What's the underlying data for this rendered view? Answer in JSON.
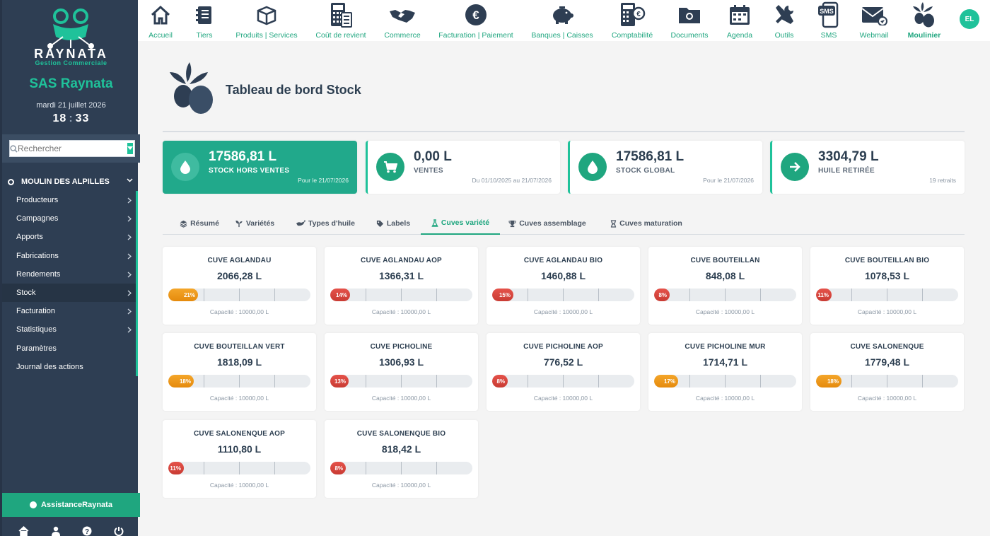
{
  "sidebar": {
    "brand": "RAYNATA",
    "brand_sub": "Gestion Commerciale",
    "company": "SAS Raynata",
    "date": "mardi 21 juillet 2026",
    "time_h": "18",
    "time_m": "33",
    "search_placeholder": "Rechercher",
    "group": "MOULIN DES ALPILLES",
    "items": [
      {
        "label": "Producteurs",
        "arrow": true
      },
      {
        "label": "Campagnes",
        "arrow": true
      },
      {
        "label": "Apports",
        "arrow": true
      },
      {
        "label": "Fabrications",
        "arrow": true
      },
      {
        "label": "Rendements",
        "arrow": true
      },
      {
        "label": "Stock",
        "arrow": true,
        "active": true
      },
      {
        "label": "Facturation",
        "arrow": true
      },
      {
        "label": "Statistiques",
        "arrow": true
      },
      {
        "label": "Paramètres",
        "arrow": false
      },
      {
        "label": "Journal des actions",
        "arrow": false
      }
    ],
    "assist": "AssistanceRaynata",
    "bottom_icons": [
      "home-icon",
      "user-icon",
      "help-icon",
      "power-icon"
    ]
  },
  "topnav": {
    "items": [
      {
        "label": "Accueil",
        "icon": "home-icon"
      },
      {
        "label": "Tiers",
        "icon": "address-book-icon"
      },
      {
        "label": "Produits | Services",
        "icon": "box-icon"
      },
      {
        "label": "Coût de revient",
        "icon": "calculator-icon"
      },
      {
        "label": "Commerce",
        "icon": "handshake-icon"
      },
      {
        "label": "Facturation | Paiement",
        "icon": "euro-icon"
      },
      {
        "label": "Banques | Caisses",
        "icon": "piggy-bank-icon"
      },
      {
        "label": "Comptabilité",
        "icon": "accounting-icon"
      },
      {
        "label": "Documents",
        "icon": "folder-icon"
      },
      {
        "label": "Agenda",
        "icon": "calendar-icon"
      },
      {
        "label": "Outils",
        "icon": "tools-icon"
      },
      {
        "label": "SMS",
        "icon": "sms-icon"
      },
      {
        "label": "Webmail",
        "icon": "mail-icon"
      },
      {
        "label": "Moulinier",
        "icon": "olive-icon",
        "active": true
      }
    ],
    "avatar": "EL"
  },
  "page": {
    "title": "Tableau de bord Stock"
  },
  "stats": [
    {
      "value": "17586,81 L",
      "label": "STOCK HORS VENTES",
      "note": "Pour le 21/07/2026",
      "icon": "drop-icon"
    },
    {
      "value": "0,00 L",
      "label": "VENTES",
      "note": "Du 01/10/2025 au 21/07/2026",
      "icon": "cart-icon"
    },
    {
      "value": "17586,81 L",
      "label": "STOCK GLOBAL",
      "note": "Pour le 21/07/2026",
      "icon": "drop-icon"
    },
    {
      "value": "3304,79 L",
      "label": "HUILE RETIRÉE",
      "note": "19 retraits",
      "icon": "arrow-right-icon"
    }
  ],
  "tabs": [
    {
      "label": "Résumé",
      "icon": "layers-icon"
    },
    {
      "label": "Variétés",
      "icon": "sprout-icon"
    },
    {
      "label": "Types d'huile",
      "icon": "oil-lamp-icon"
    },
    {
      "label": "Labels",
      "icon": "tag-icon"
    },
    {
      "label": "Cuves variété",
      "icon": "flask-icon",
      "active": true
    },
    {
      "label": "Cuves assemblage",
      "icon": "trophy-icon"
    },
    {
      "label": "Cuves maturation",
      "icon": "hourglass-icon"
    }
  ],
  "colors": {
    "accent": "#1fa67f",
    "sidebar": "#2e3e53",
    "orange": "#f39c12",
    "red": "#d9443c"
  },
  "cuves": [
    {
      "name": "CUVE AGLANDAU",
      "volume": "2066,28 L",
      "percent": 21,
      "percent_label": "21%",
      "color": "orange",
      "capacity": "Capacité : 10000,00 L"
    },
    {
      "name": "CUVE AGLANDAU AOP",
      "volume": "1366,31 L",
      "percent": 14,
      "percent_label": "14%",
      "color": "red",
      "capacity": "Capacité : 10000,00 L"
    },
    {
      "name": "CUVE AGLANDAU BIO",
      "volume": "1460,88 L",
      "percent": 15,
      "percent_label": "15%",
      "color": "red",
      "capacity": "Capacité : 10000,00 L"
    },
    {
      "name": "CUVE BOUTEILLAN",
      "volume": "848,08 L",
      "percent": 8,
      "percent_label": "8%",
      "color": "red",
      "capacity": "Capacité : 10000,00 L"
    },
    {
      "name": "CUVE BOUTEILLAN BIO",
      "volume": "1078,53 L",
      "percent": 11,
      "percent_label": "11%",
      "color": "red",
      "capacity": "Capacité : 10000,00 L"
    },
    {
      "name": "CUVE BOUTEILLAN VERT",
      "volume": "1818,09 L",
      "percent": 18,
      "percent_label": "18%",
      "color": "orange",
      "capacity": "Capacité : 10000,00 L"
    },
    {
      "name": "CUVE PICHOLINE",
      "volume": "1306,93 L",
      "percent": 13,
      "percent_label": "13%",
      "color": "red",
      "capacity": "Capacité : 10000,00 L"
    },
    {
      "name": "CUVE PICHOLINE AOP",
      "volume": "776,52 L",
      "percent": 8,
      "percent_label": "8%",
      "color": "red",
      "capacity": "Capacité : 10000,00 L"
    },
    {
      "name": "CUVE PICHOLINE MUR",
      "volume": "1714,71 L",
      "percent": 17,
      "percent_label": "17%",
      "color": "orange",
      "capacity": "Capacité : 10000,00 L"
    },
    {
      "name": "CUVE SALONENQUE",
      "volume": "1779,48 L",
      "percent": 18,
      "percent_label": "18%",
      "color": "orange",
      "capacity": "Capacité : 10000,00 L"
    },
    {
      "name": "CUVE SALONENQUE AOP",
      "volume": "1110,80 L",
      "percent": 11,
      "percent_label": "11%",
      "color": "red",
      "capacity": "Capacité : 10000,00 L"
    },
    {
      "name": "CUVE SALONENQUE BIO",
      "volume": "818,42 L",
      "percent": 8,
      "percent_label": "8%",
      "color": "red",
      "capacity": "Capacité : 10000,00 L"
    }
  ]
}
